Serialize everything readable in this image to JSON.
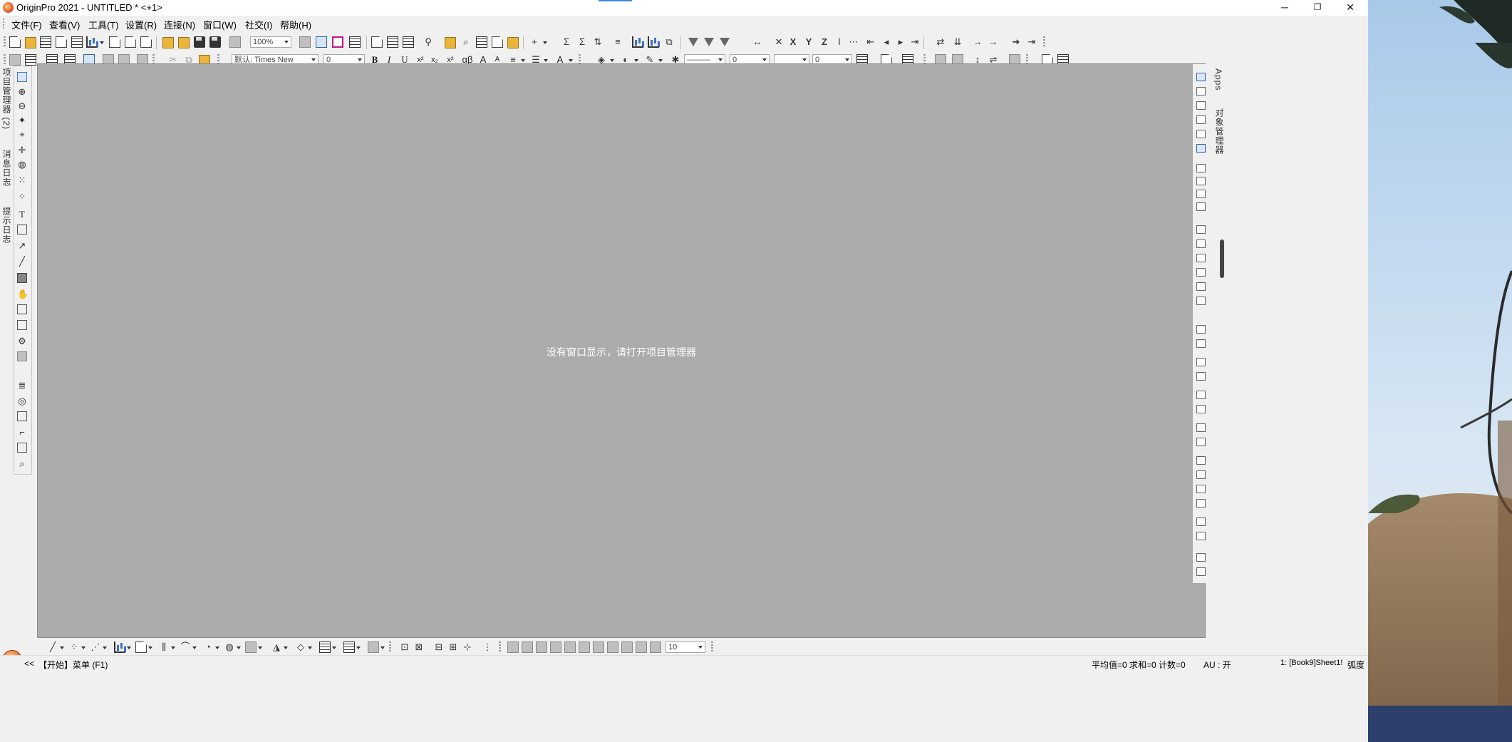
{
  "window": {
    "title": "OriginPro 2021 - UNTITLED * <+1>",
    "minimize_glyph": "─",
    "maximize_glyph": "❐",
    "close_glyph": "✕"
  },
  "menu": [
    {
      "label": "文件(F)"
    },
    {
      "label": "查看(V)"
    },
    {
      "label": "工具(T)"
    },
    {
      "label": "设置(R)"
    },
    {
      "label": "连接(N)"
    },
    {
      "label": "窗口(W)"
    },
    {
      "label": "社交(I)"
    },
    {
      "label": "帮助(H)"
    }
  ],
  "toolbar": {
    "zoom_value": "100%",
    "font_name": "默认: Times New",
    "font_size": "0",
    "line_width": "0",
    "fill_value": "0",
    "bottom_value": "10",
    "line_style": "———"
  },
  "format_buttons": {
    "bold": "B",
    "italic": "I",
    "underline": "U",
    "superscript": "x²",
    "subscript": "x₂",
    "super_sub": "x²",
    "greek": "αβ",
    "increase_font": "A",
    "decrease_font": "A",
    "text_tool": "T",
    "x_axis": "X",
    "y_axis": "Y",
    "z_axis": "Z"
  },
  "side_tabs": {
    "project_manager": "项目管理器 (2)",
    "messages_log": "消息日志",
    "hints_log": "提示日志",
    "apps": "Apps",
    "object_manager": "对象管理器"
  },
  "workspace": {
    "empty_message": "没有窗口显示，请打开项目管理器"
  },
  "status": {
    "nav_back": "<<",
    "start_menu": "【开始】菜单 (F1)",
    "statistics": "平均值=0 求和=0 计数=0",
    "au_mode": "AU : 开",
    "active_sheet": "1: [Book9]Sheet1!",
    "angle_unit": "弧度"
  }
}
